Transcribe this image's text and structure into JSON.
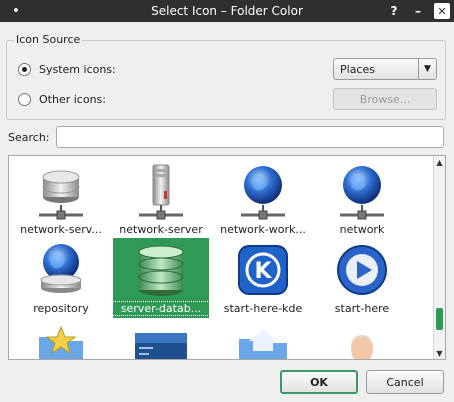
{
  "window": {
    "title": "Select Icon – Folder Color",
    "menu_glyph": "•",
    "help_glyph": "?",
    "minimize_glyph": "–",
    "close_glyph": "✕"
  },
  "icon_source": {
    "group_title": "Icon Source",
    "system_label": "System icons:",
    "other_label": "Other icons:",
    "system_checked": true,
    "category_selected": "Places",
    "browse_label": "Browse..."
  },
  "search": {
    "label": "Search:",
    "value": "",
    "placeholder": ""
  },
  "icons": [
    {
      "label": "network-serv...",
      "kind": "db-server",
      "selected": false
    },
    {
      "label": "network-server",
      "kind": "tower",
      "selected": false
    },
    {
      "label": "network-work...",
      "kind": "globe-net",
      "selected": false
    },
    {
      "label": "network",
      "kind": "globe-net",
      "selected": false
    },
    {
      "label": "repository",
      "kind": "globe",
      "selected": false
    },
    {
      "label": "server-datab...",
      "kind": "database",
      "selected": true
    },
    {
      "label": "start-here-kde",
      "kind": "kde",
      "selected": false
    },
    {
      "label": "start-here",
      "kind": "play",
      "selected": false
    },
    {
      "label": "",
      "kind": "folder-star",
      "selected": false
    },
    {
      "label": "",
      "kind": "blue-panel",
      "selected": false
    },
    {
      "label": "",
      "kind": "folder-home",
      "selected": false
    },
    {
      "label": "",
      "kind": "person",
      "selected": false
    }
  ],
  "buttons": {
    "ok": "OK",
    "cancel": "Cancel"
  },
  "colors": {
    "selection": "#2e9a55",
    "titlebar": "#2f2f2f"
  }
}
